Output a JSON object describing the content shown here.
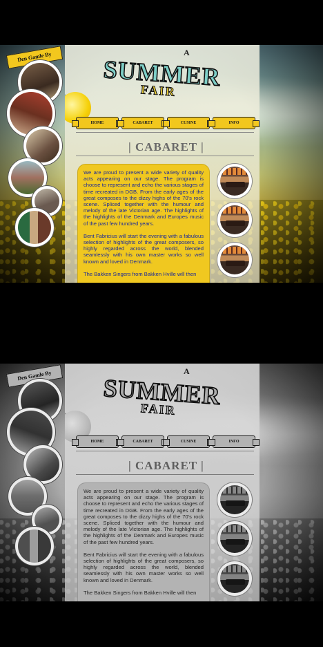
{
  "logo": {
    "text": "Den Gamle By"
  },
  "title": {
    "small": "A",
    "main": "SUMMER",
    "sub": "FAIR"
  },
  "nav": {
    "items": [
      {
        "label": "HOME"
      },
      {
        "label": "CABARET"
      },
      {
        "label": "CUSINE"
      },
      {
        "label": "INFO"
      }
    ]
  },
  "page": {
    "heading": "| CABARET |"
  },
  "content": {
    "paragraphs": [
      "We are proud to present a wide variety of quality acts appearing on our stage. The program is choose to represent and echo the various stages of time recreated in DGB. From the early ages of the great composes to the dizzy highs of the 70's rock scene. Spliced together with the humour and melody of the late Victorian age. The highlights of the highlights of the Denmark and Europes music of the past few hundred years.",
      "Bent Fabricius will start the evening with a fabulous selection of highlights of the great composers, so highly regarded across the world, blended seamlessly with his own master works so well known and loved in Denmark.",
      "The Bakken Singers from Bakken Hville will then"
    ]
  },
  "colors": {
    "accent": "#f0c820",
    "text": "#1a2a9a",
    "ribbon": "#f2c71e"
  },
  "icons": {
    "side_photos": "photo-circle",
    "thumbs": "cabaret-thumbnail"
  }
}
